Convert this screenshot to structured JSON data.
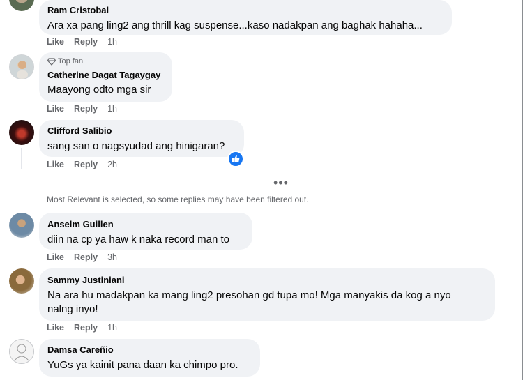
{
  "comments": [
    {
      "name": "Ram Cristobal",
      "text_lines": [
        "Ara xa pang ling2 ang thrill kag suspense...kaso nadakpan ang baghak hahaha..."
      ],
      "like": "Like",
      "reply": "Reply",
      "time": "1h"
    },
    {
      "badge": "Top fan",
      "name": "Catherine Dagat Tagaygay",
      "text_lines": [
        "Maayong odto mga sir"
      ],
      "like": "Like",
      "reply": "Reply",
      "time": "1h"
    },
    {
      "name": "Clifford Salibio",
      "text_lines": [
        "sang san o nagsyudad ang hinigaran?"
      ],
      "like": "Like",
      "reply": "Reply",
      "time": "2h",
      "reaction": "like-reaction-icon"
    },
    {
      "name": "Anselm Guillen",
      "text_lines": [
        "diin na cp ya haw k naka record man to"
      ],
      "like": "Like",
      "reply": "Reply",
      "time": "3h"
    },
    {
      "name": "Sammy Justiniani",
      "text_lines": [
        "Na ara hu madakpan ka mang ling2 presohan gd tupa mo! Mga manyakis da kog a nyo",
        "nalng inyo!"
      ],
      "like": "Like",
      "reply": "Reply",
      "time": "1h"
    },
    {
      "name": "Damsa Careñio",
      "text_lines": [
        "YuGs ya kainit pana daan ka chimpo pro."
      ]
    }
  ],
  "notice": "Most Relevant is selected, so some replies may have been filtered out.",
  "more": "•••",
  "colors": {
    "bubble": "#f0f2f5",
    "meta": "#65676b",
    "like_blue": "#1877f2"
  }
}
